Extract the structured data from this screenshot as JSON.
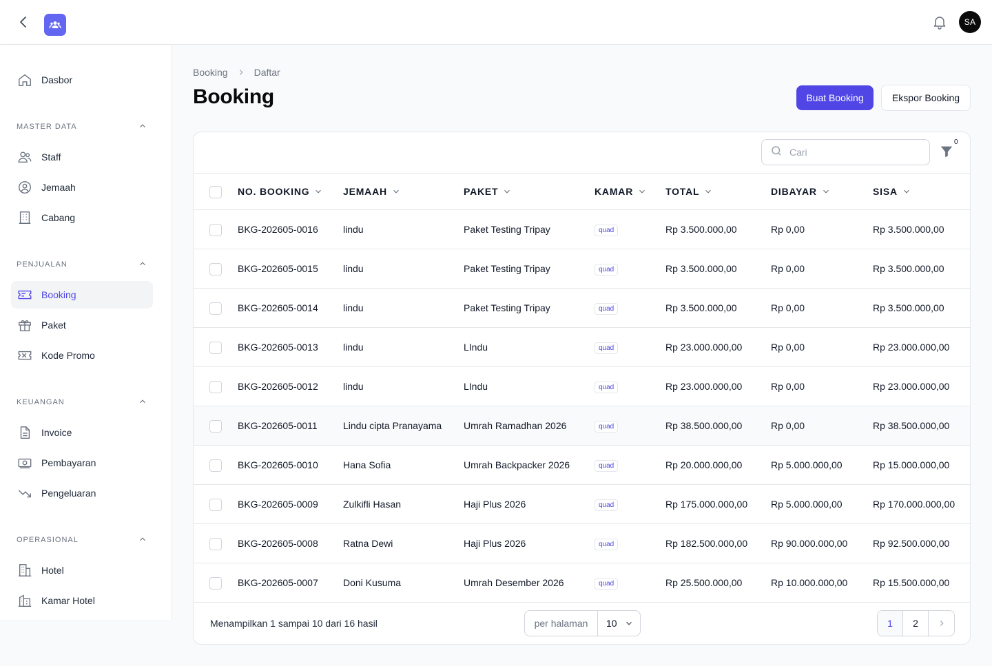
{
  "header": {
    "avatar_initials": "SA",
    "accent": "#4f46e5"
  },
  "sidebar": {
    "dasbor": "Dasbor",
    "sections": {
      "master_data": "MASTER DATA",
      "penjualan": "PENJUALAN",
      "keuangan": "KEUANGAN",
      "operasional": "OPERASIONAL"
    },
    "items": {
      "staff": "Staff",
      "jemaah": "Jemaah",
      "cabang": "Cabang",
      "booking": "Booking",
      "paket": "Paket",
      "kode_promo": "Kode Promo",
      "invoice": "Invoice",
      "pembayaran": "Pembayaran",
      "pengeluaran": "Pengeluaran",
      "hotel": "Hotel",
      "kamar_hotel": "Kamar Hotel"
    }
  },
  "breadcrumb": {
    "parent": "Booking",
    "current": "Daftar"
  },
  "page": {
    "title": "Booking",
    "create_button": "Buat Booking",
    "export_button": "Ekspor Booking"
  },
  "toolbar": {
    "search_placeholder": "Cari",
    "filter_count": "0"
  },
  "table": {
    "columns": {
      "no_booking": "NO. BOOKING",
      "jemaah": "JEMAAH",
      "paket": "PAKET",
      "kamar": "KAMAR",
      "total": "TOTAL",
      "dibayar": "DIBAYAR",
      "sisa": "SISA"
    },
    "rows": [
      {
        "no": "BKG-202605-0016",
        "jemaah": "lindu",
        "paket": "Paket Testing Tripay",
        "kamar": "quad",
        "total": "Rp 3.500.000,00",
        "dibayar": "Rp 0,00",
        "sisa": "Rp 3.500.000,00"
      },
      {
        "no": "BKG-202605-0015",
        "jemaah": "lindu",
        "paket": "Paket Testing Tripay",
        "kamar": "quad",
        "total": "Rp 3.500.000,00",
        "dibayar": "Rp 0,00",
        "sisa": "Rp 3.500.000,00"
      },
      {
        "no": "BKG-202605-0014",
        "jemaah": "lindu",
        "paket": "Paket Testing Tripay",
        "kamar": "quad",
        "total": "Rp 3.500.000,00",
        "dibayar": "Rp 0,00",
        "sisa": "Rp 3.500.000,00"
      },
      {
        "no": "BKG-202605-0013",
        "jemaah": "lindu",
        "paket": "LIndu",
        "kamar": "quad",
        "total": "Rp 23.000.000,00",
        "dibayar": "Rp 0,00",
        "sisa": "Rp 23.000.000,00"
      },
      {
        "no": "BKG-202605-0012",
        "jemaah": "lindu",
        "paket": "LIndu",
        "kamar": "quad",
        "total": "Rp 23.000.000,00",
        "dibayar": "Rp 0,00",
        "sisa": "Rp 23.000.000,00"
      },
      {
        "no": "BKG-202605-0011",
        "jemaah": "Lindu cipta Pranayama",
        "paket": "Umrah Ramadhan 2026",
        "kamar": "quad",
        "total": "Rp 38.500.000,00",
        "dibayar": "Rp 0,00",
        "sisa": "Rp 38.500.000,00"
      },
      {
        "no": "BKG-202605-0010",
        "jemaah": "Hana Sofia",
        "paket": "Umrah Backpacker 2026",
        "kamar": "quad",
        "total": "Rp 20.000.000,00",
        "dibayar": "Rp 5.000.000,00",
        "sisa": "Rp 15.000.000,00"
      },
      {
        "no": "BKG-202605-0009",
        "jemaah": "Zulkifli Hasan",
        "paket": "Haji Plus 2026",
        "kamar": "quad",
        "total": "Rp 175.000.000,00",
        "dibayar": "Rp 5.000.000,00",
        "sisa": "Rp 170.000.000,00"
      },
      {
        "no": "BKG-202605-0008",
        "jemaah": "Ratna Dewi",
        "paket": "Haji Plus 2026",
        "kamar": "quad",
        "total": "Rp 182.500.000,00",
        "dibayar": "Rp 90.000.000,00",
        "sisa": "Rp 92.500.000,00"
      },
      {
        "no": "BKG-202605-0007",
        "jemaah": "Doni Kusuma",
        "paket": "Umrah Desember 2026",
        "kamar": "quad",
        "total": "Rp 25.500.000,00",
        "dibayar": "Rp 10.000.000,00",
        "sisa": "Rp 15.500.000,00"
      }
    ]
  },
  "footer": {
    "summary": "Menampilkan 1 sampai 10 dari 16 hasil",
    "per_page_label": "per halaman",
    "per_page_value": "10",
    "pages": [
      "1",
      "2"
    ]
  }
}
